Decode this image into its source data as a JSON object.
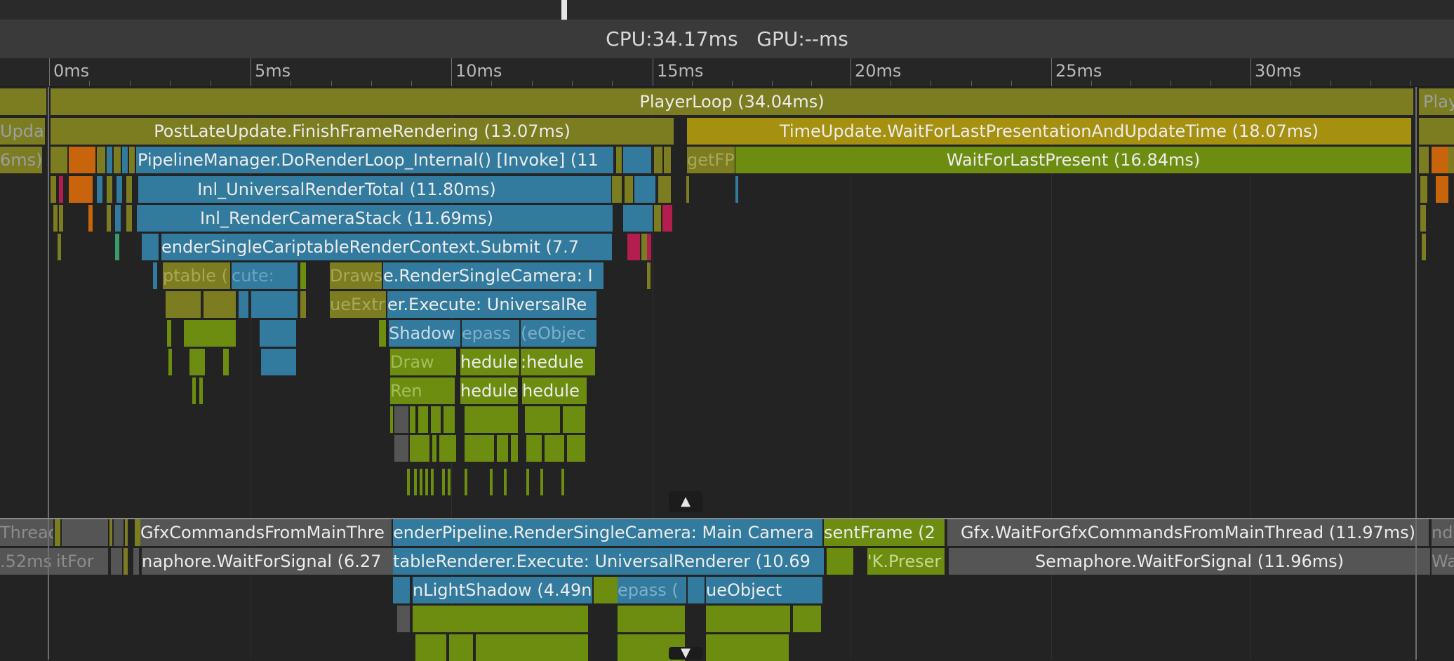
{
  "stats": {
    "cpu": "CPU:34.17ms",
    "gpu": "GPU:--ms"
  },
  "ruler": {
    "labels": [
      "0ms",
      "5ms",
      "10ms",
      "15ms",
      "20ms",
      "25ms",
      "30ms"
    ]
  },
  "main_thread": {
    "player_loop": "PlayerLoop (34.04ms)",
    "player_loop_next": "Playe",
    "prev_update": "Update",
    "post_late_update": "PostLateUpdate.FinishFrameRendering (13.07ms)",
    "time_update": "TimeUpdate.WaitForLastPresentationAndUpdateTime (18.07ms)",
    "prev_duration": "6ms)",
    "pipeline_manager": "PipelineManager.DoRenderLoop_Internal() [Invoke] (11",
    "get_fps": "getFPS",
    "wait_for_last_present": "WaitForLastPresent (16.84ms)",
    "universal_render_total": "Inl_UniversalRenderTotal (11.80ms)",
    "render_camera_stack": "Inl_RenderCameraStack (11.69ms)",
    "render_single_camera_submit": "enderSingleCa",
    "scriptable_submit": "riptableRenderContext.Submit (7.7",
    "scriptable": "ptable (",
    "execute": "cute:",
    "draws": "Draws",
    "render_single_camera": "e.RenderSingleCamera: I",
    "queue_extract": "ueExtr",
    "renderer_execute": "er.Execute: UniversalRe",
    "shadow": "Shadow",
    "epass": "epass",
    "que_object": "(eObjec",
    "schedule_1": "hedule",
    "schedule_2": ":hedule",
    "schedule_3": "hedule",
    "schedule_4": "hedule",
    "draw_faded": "Draw",
    "ren_faded": "Ren"
  },
  "render_thread": {
    "threads_from": "ThreadsFro",
    "gfx_commands_from_main_thread": "GfxCommandsFromMainThre",
    "render_single_camera": "enderPipeline.RenderSingleCamera: Main Camera",
    "present_frame": "sentFrame (2",
    "wait_for_gfx": "Gfx.WaitForGfxCommandsFromMainThread (11.97ms)",
    "next_gfx": "nd",
    "prev_value": ".52ms",
    "wait_for_faded": "itFor",
    "semaphore_wait_1": "naphore.WaitForSignal (6.27",
    "renderer_execute": "tableRenderer.Execute: UniversalRenderer (10.69",
    "gfx_present": "'K.Preser",
    "semaphore_wait_2": "Semaphore.WaitForSignal (11.96ms)",
    "next_wait": "Wa",
    "light_shadow": "nLightShadow (4.49n",
    "epass": "epass (",
    "que_object": "ueObject"
  },
  "colors": {
    "olive": "#7c7c21",
    "blue": "#327a9e",
    "lime": "#6d8d10",
    "gold": "#a5900f",
    "gray": "#555555",
    "orange": "#c8650c",
    "magenta": "#b31e4e",
    "background": "#232323"
  }
}
